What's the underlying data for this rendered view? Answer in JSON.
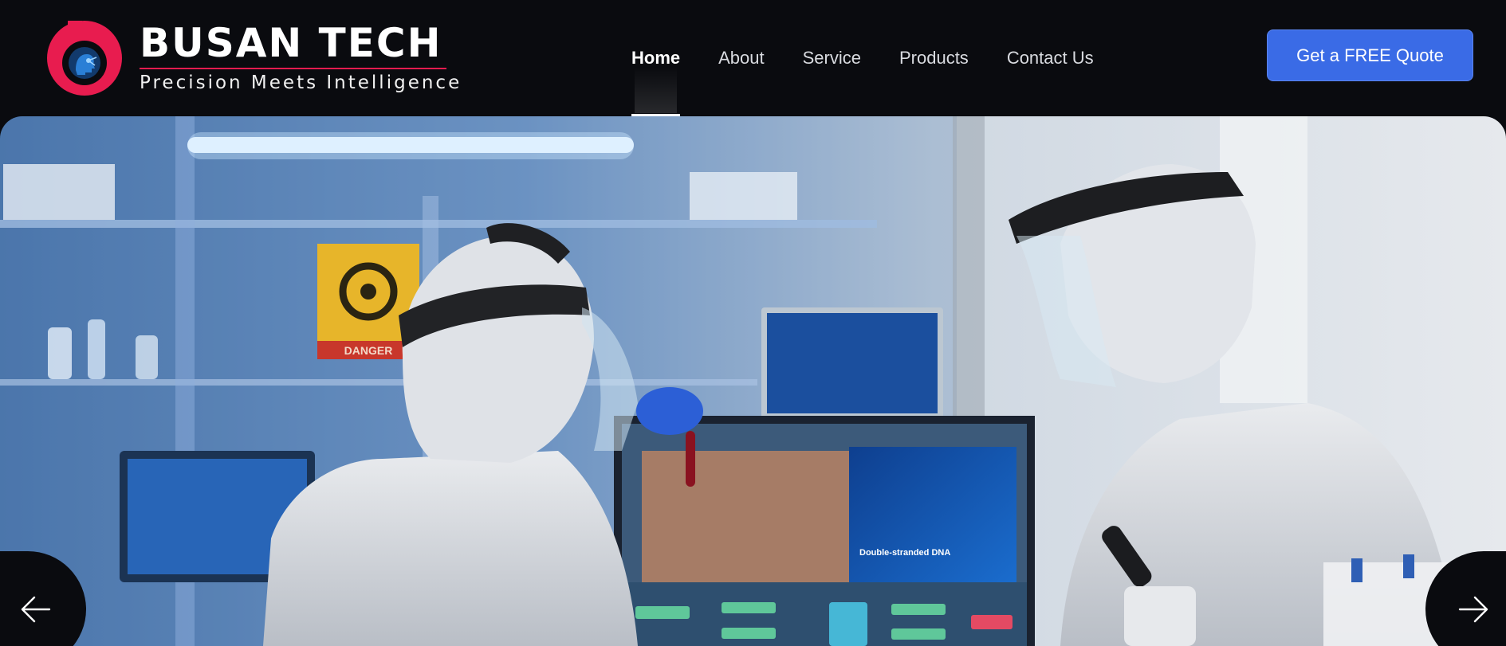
{
  "brand": {
    "name": "BUSAN TECH",
    "tagline": "Precision Meets Intelligence",
    "accent_color": "#e81c4f"
  },
  "nav": {
    "items": [
      {
        "label": "Home",
        "active": true
      },
      {
        "label": "About",
        "active": false
      },
      {
        "label": "Service",
        "active": false
      },
      {
        "label": "Products",
        "active": false
      },
      {
        "label": "Contact Us",
        "active": false
      }
    ]
  },
  "cta": {
    "label": "Get a FREE Quote",
    "color": "#3a6be6"
  },
  "hero": {
    "image": "laboratory-scientists-dna-research",
    "sign_text": "DANGER",
    "screen_caption": "Double-stranded DNA",
    "prev_icon": "arrow-left-icon",
    "next_icon": "arrow-right-icon"
  }
}
